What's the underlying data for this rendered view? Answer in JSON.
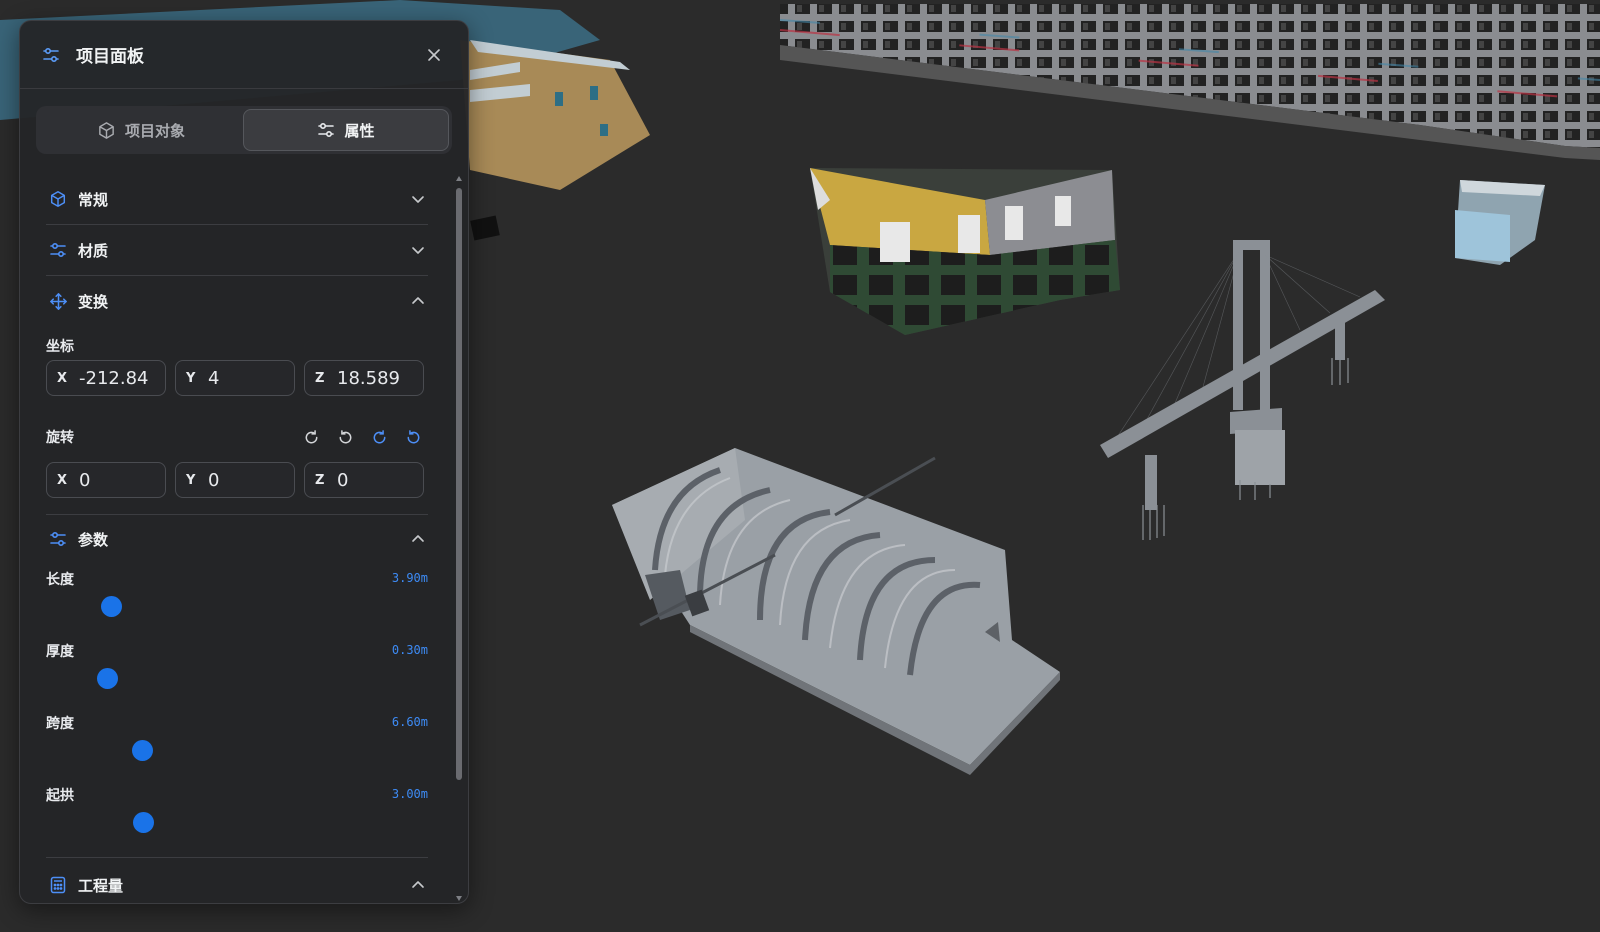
{
  "panel": {
    "title": "项目面板",
    "tabs": [
      {
        "label": "项目对象",
        "icon": "cube-icon",
        "active": false
      },
      {
        "label": "属性",
        "icon": "sliders-icon",
        "active": true
      }
    ]
  },
  "sections": {
    "general": {
      "label": "常规",
      "icon": "cube-icon",
      "expanded": false
    },
    "material": {
      "label": "材质",
      "icon": "sliders-icon",
      "expanded": false
    },
    "transform": {
      "label": "变换",
      "icon": "move-icon",
      "expanded": true
    },
    "params": {
      "label": "参数",
      "icon": "sliders-icon",
      "expanded": true
    },
    "quantity": {
      "label": "工程量",
      "icon": "calculator-icon",
      "expanded": true
    }
  },
  "transform": {
    "position_label": "坐标",
    "position": {
      "x": "-212.84",
      "y": "4",
      "z": "18.589"
    },
    "rotation_label": "旋转",
    "rotation": {
      "x": "0",
      "y": "0",
      "z": "0"
    }
  },
  "axes": {
    "x": "X",
    "y": "Y",
    "z": "Z"
  },
  "parameters": [
    {
      "label": "长度",
      "value": "3.90m",
      "fraction": 0.17
    },
    {
      "label": "厚度",
      "value": "0.30m",
      "fraction": 0.16
    },
    {
      "label": "跨度",
      "value": "6.60m",
      "fraction": 0.25
    },
    {
      "label": "起拱",
      "value": "3.00m",
      "fraction": 0.255
    }
  ],
  "colors": {
    "accent": "#1a73e8",
    "value_text": "#3d8bf5",
    "panel_bg": "#242528",
    "viewport_bg": "#2b2b2b"
  }
}
